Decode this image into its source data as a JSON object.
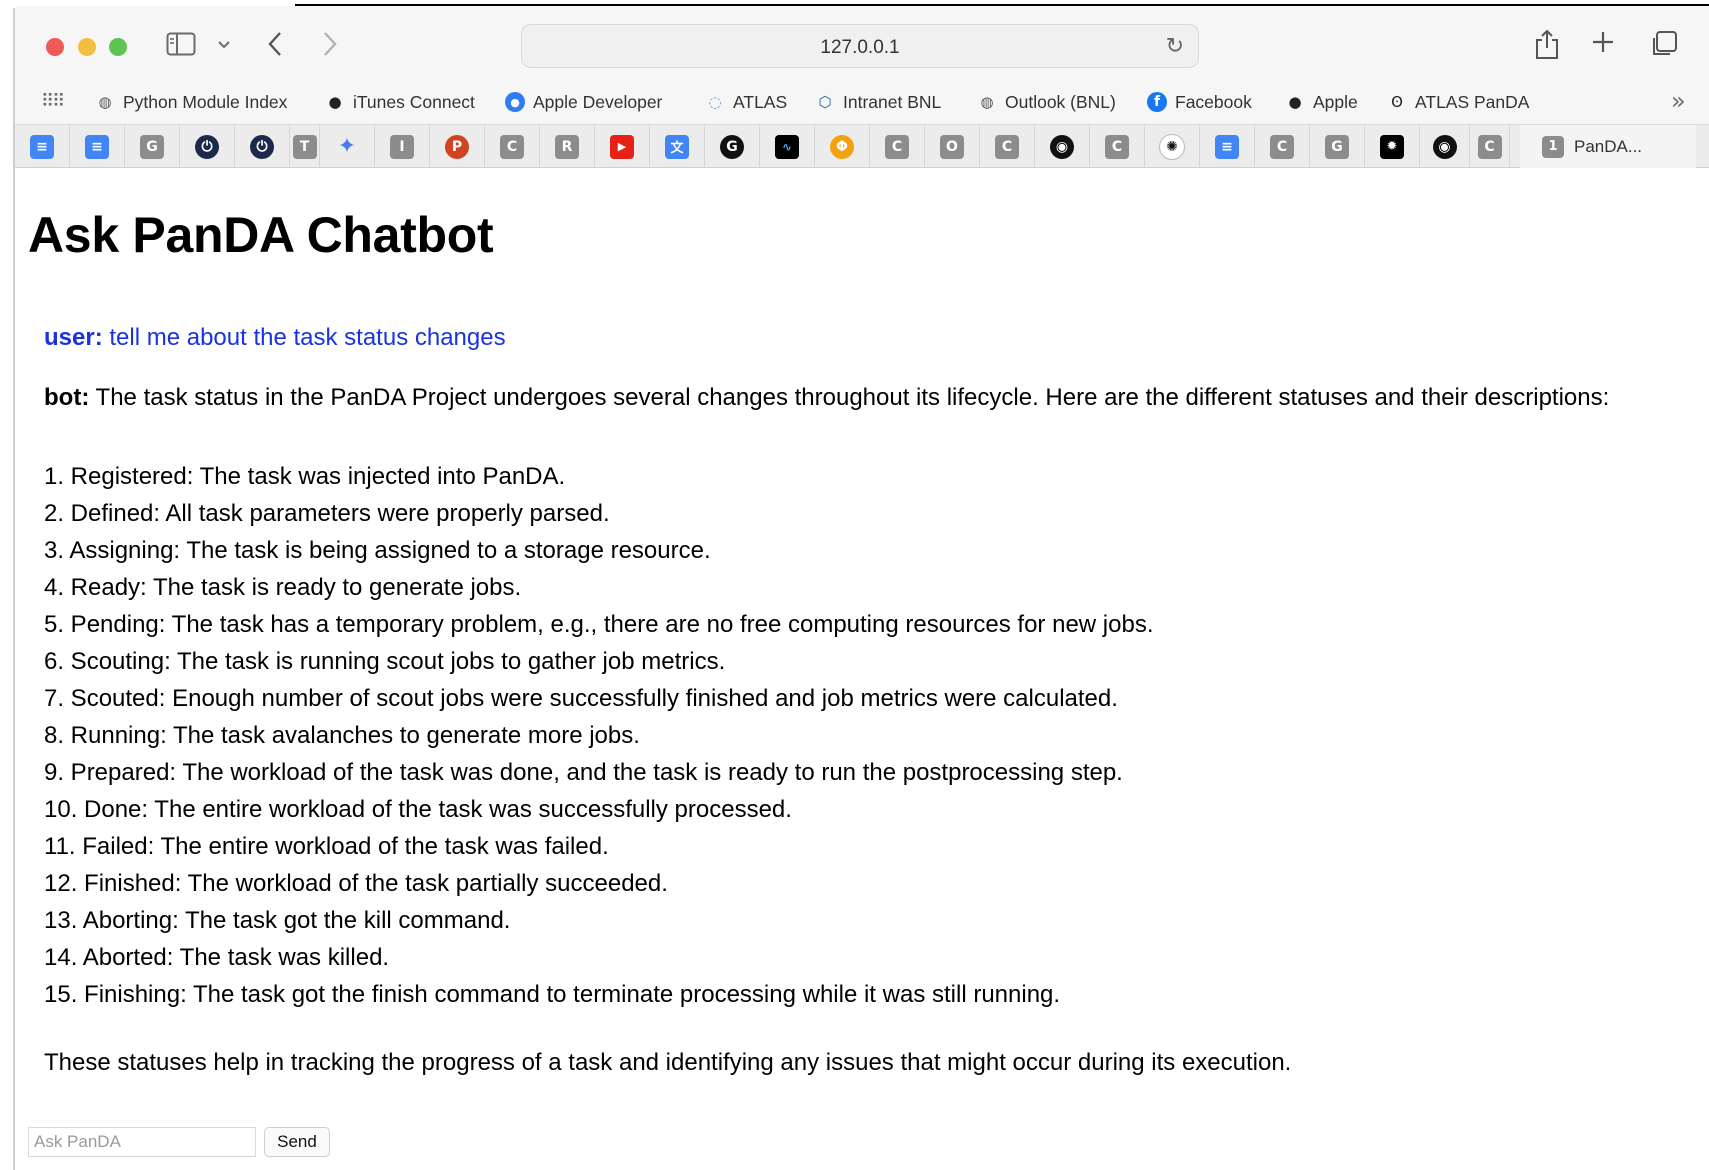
{
  "browser": {
    "url": "127.0.0.1",
    "bookmarks": [
      {
        "label": "Python Module Index",
        "icon": "globe-icon"
      },
      {
        "label": "iTunes Connect",
        "icon": "apple-icon"
      },
      {
        "label": "Apple Developer",
        "icon": "apple-developer-icon"
      },
      {
        "label": "ATLAS",
        "icon": "atlas-icon"
      },
      {
        "label": "Intranet BNL",
        "icon": "bnl-icon"
      },
      {
        "label": "Outlook (BNL)",
        "icon": "globe-icon"
      },
      {
        "label": "Facebook",
        "icon": "facebook-icon"
      },
      {
        "label": "Apple",
        "icon": "apple-icon"
      },
      {
        "label": "ATLAS PanDA",
        "icon": "panda-icon"
      }
    ],
    "pinned_tab_letters": {
      "g": "G",
      "t": "T",
      "i": "I",
      "p": "P",
      "c": "C",
      "r": "R",
      "o": "O"
    },
    "active_tab": {
      "badge": "1",
      "label": "PanDA..."
    }
  },
  "page": {
    "title": "Ask PanDA Chatbot",
    "user_label": "user:",
    "user_message": "tell me about the task status changes",
    "bot_label": "bot:",
    "bot_intro": "The task status in the PanDA Project undergoes several changes throughout its lifecycle. Here are the different statuses and their descriptions:",
    "statuses": [
      "1. Registered: The task was injected into PanDA.",
      "2. Defined: All task parameters were properly parsed.",
      "3. Assigning: The task is being assigned to a storage resource.",
      "4. Ready: The task is ready to generate jobs.",
      "5. Pending: The task has a temporary problem, e.g., there are no free computing resources for new jobs.",
      "6. Scouting: The task is running scout jobs to gather job metrics.",
      "7. Scouted: Enough number of scout jobs were successfully finished and job metrics were calculated.",
      "8. Running: The task avalanches to generate more jobs.",
      "9. Prepared: The workload of the task was done, and the task is ready to run the postprocessing step.",
      "10. Done: The entire workload of the task was successfully processed.",
      "11. Failed: The entire workload of the task was failed.",
      "12. Finished: The workload of the task partially succeeded.",
      "13. Aborting: The task got the kill command.",
      "14. Aborted: The task was killed.",
      "15. Finishing: The task got the finish command to terminate processing while it was still running."
    ],
    "summary": "These statuses help in tracking the progress of a task and identifying any issues that might occur during its execution.",
    "input_placeholder": "Ask PanDA",
    "send_label": "Send"
  }
}
